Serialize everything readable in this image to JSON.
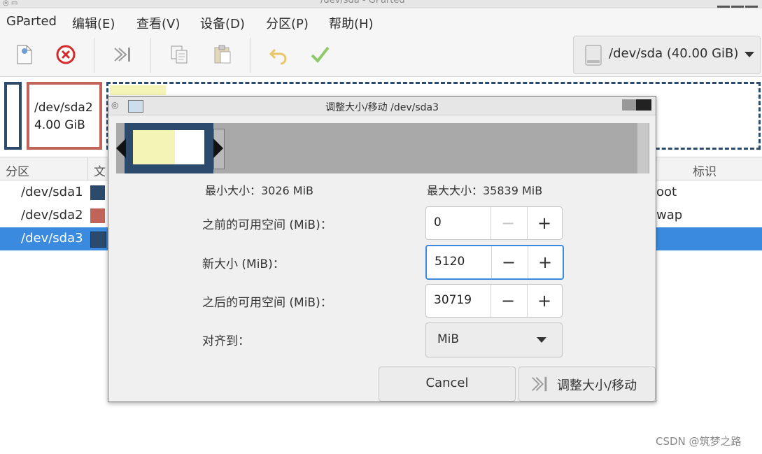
{
  "window": {
    "title": "/dev/sda - GParted"
  },
  "menu": [
    {
      "label": "GParted"
    },
    {
      "label": "编辑(E)"
    },
    {
      "label": "查看(V)"
    },
    {
      "label": "设备(D)"
    },
    {
      "label": "分区(P)"
    },
    {
      "label": "帮助(H)"
    }
  ],
  "toolbar": {
    "icons": [
      "new-icon",
      "delete-icon",
      "resize-move-icon",
      "copy-icon",
      "paste-icon",
      "undo-icon",
      "apply-icon"
    ],
    "device": "/dev/sda (40.00 GiB)"
  },
  "partition_bar": {
    "sda2_name": "/dev/sda2",
    "sda2_size": "4.00 GiB"
  },
  "partition_list": {
    "headers": {
      "partition": "分区",
      "filesystem": "文",
      "label": "标识"
    },
    "rows": [
      {
        "name": "/dev/sda1",
        "color": "#2c4a6b",
        "label": "oot",
        "selected": false
      },
      {
        "name": "/dev/sda2",
        "color": "#c0645a",
        "label": "wap",
        "selected": false
      },
      {
        "name": "/dev/sda3",
        "color": "#2c4a6b",
        "label": "",
        "selected": true
      }
    ]
  },
  "dialog": {
    "title": "调整大小/移动 /dev/sda3",
    "min_size": "最小大小：3026 MiB",
    "max_size": "最大大小：35839 MiB",
    "fields": {
      "before": {
        "label": "之前的可用空间 (MiB)：",
        "value": "0"
      },
      "new_size": {
        "label": "新大小 (MiB)：",
        "value": "5120"
      },
      "after": {
        "label": "之后的可用空间 (MiB)：",
        "value": "30719"
      }
    },
    "align": {
      "label": "对齐到：",
      "value": "MiB"
    },
    "cancel_label": "Cancel",
    "resize_label": "调整大小/移动"
  },
  "watermark": "CSDN @筑梦之路"
}
